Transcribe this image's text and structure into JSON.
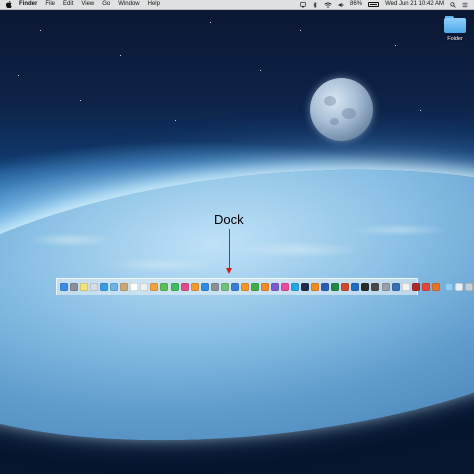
{
  "menubar": {
    "app_name": "Finder",
    "menus": [
      "File",
      "Edit",
      "View",
      "Go",
      "Window",
      "Help"
    ],
    "battery_percent": "86%",
    "clock": "Wed Jun 21  10:42 AM"
  },
  "desktop": {
    "folder_label": "Folder",
    "annotation_label": "Dock"
  },
  "dock": {
    "apps": [
      {
        "icon": "finder-icon",
        "color": "#3a8ee6"
      },
      {
        "icon": "launchpad-icon",
        "color": "#8a8f99"
      },
      {
        "icon": "notes-icon",
        "color": "#f2e37a"
      },
      {
        "icon": "preview-icon",
        "color": "#d9dde3"
      },
      {
        "icon": "safari-icon",
        "color": "#3c9be0"
      },
      {
        "icon": "mail-icon",
        "color": "#6ab3ea"
      },
      {
        "icon": "contacts-icon",
        "color": "#c9a878"
      },
      {
        "icon": "calendar-icon",
        "color": "#ffffff"
      },
      {
        "icon": "reminders-icon",
        "color": "#f0f0f0"
      },
      {
        "icon": "photos-icon",
        "color": "#f2a43b"
      },
      {
        "icon": "messages-icon",
        "color": "#5ac05a"
      },
      {
        "icon": "facetime-icon",
        "color": "#3fbf5a"
      },
      {
        "icon": "itunes-icon",
        "color": "#e24b8a"
      },
      {
        "icon": "ibooks-icon",
        "color": "#f29b2a"
      },
      {
        "icon": "app-store-icon",
        "color": "#2f8ae0"
      },
      {
        "icon": "system-preferences-icon",
        "color": "#8b9099"
      },
      {
        "icon": "maps-icon",
        "color": "#6fc27a"
      },
      {
        "icon": "keynote-icon",
        "color": "#3a7fd6"
      },
      {
        "icon": "pages-icon",
        "color": "#f0962a"
      },
      {
        "icon": "numbers-icon",
        "color": "#3fae4b"
      },
      {
        "icon": "garageband-icon",
        "color": "#f28a2a"
      },
      {
        "icon": "imovie-icon",
        "color": "#7a5bd6"
      },
      {
        "icon": "itunes-music-icon",
        "color": "#e84aa0"
      },
      {
        "icon": "skype-icon",
        "color": "#21a8e6"
      },
      {
        "icon": "steam-icon",
        "color": "#1f2d48"
      },
      {
        "icon": "vlc-icon",
        "color": "#f08a1c"
      },
      {
        "icon": "word-icon",
        "color": "#2b5fb4"
      },
      {
        "icon": "excel-icon",
        "color": "#1f8a45"
      },
      {
        "icon": "powerpoint-icon",
        "color": "#d2492a"
      },
      {
        "icon": "outlook-icon",
        "color": "#1e6fc4"
      },
      {
        "icon": "terminal-icon",
        "color": "#2a2a2a"
      },
      {
        "icon": "activity-monitor-icon",
        "color": "#4a4a4a"
      },
      {
        "icon": "disk-utility-icon",
        "color": "#9aa0a8"
      },
      {
        "icon": "quicktime-icon",
        "color": "#3a6fb0"
      },
      {
        "icon": "textedit-icon",
        "color": "#f2f2f2"
      },
      {
        "icon": "photo-booth-icon",
        "color": "#b02a2a"
      },
      {
        "icon": "chrome-icon",
        "color": "#e0483a"
      },
      {
        "icon": "firefox-icon",
        "color": "#e8742a"
      }
    ],
    "trailing": [
      {
        "icon": "downloads-folder-icon",
        "color": "#8fcff5"
      },
      {
        "icon": "documents-stack-icon",
        "color": "#e8eef4"
      },
      {
        "icon": "trash-icon",
        "color": "#c9ced4"
      }
    ]
  }
}
